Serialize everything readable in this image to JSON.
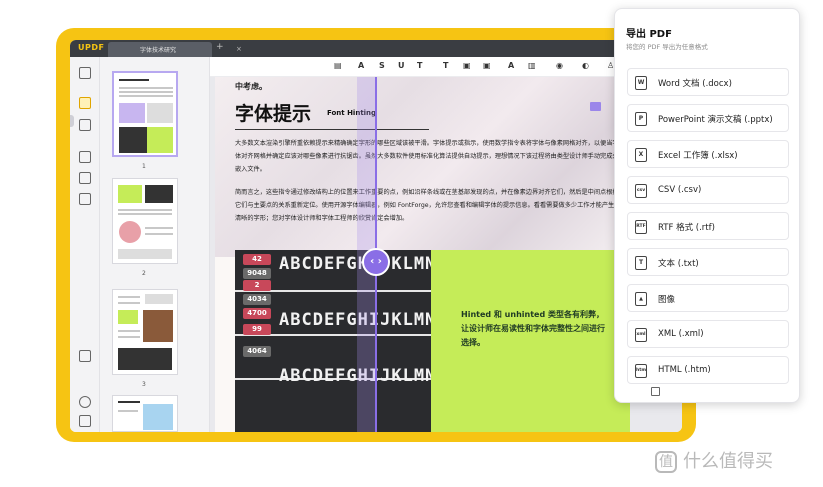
{
  "titlebar": {
    "logo_brand": "UPDF",
    "tab_label": "字体技术研究",
    "tab_close": "×",
    "tab_add": "+"
  },
  "toolbar": {
    "tools": [
      "▤",
      "A",
      "S",
      "U",
      "T",
      "T",
      "▣",
      "▣",
      "A",
      "▥",
      "◉",
      "◐",
      "♙",
      "♙"
    ]
  },
  "thumbnails": {
    "pages": [
      "1",
      "2",
      "3"
    ]
  },
  "document": {
    "top_snippet": "中考虑。",
    "heading": "字体提示",
    "heading_en": "Font Hinting",
    "paragraph1": "大多数文本渲染引擎所重依赖提示来精确确定字形的哪些区域该被平滑。字体提示或指示，使用数学指令表将字体与像素网格对齐，以便当字体对齐网格并确定应该对哪些像素进行抗锯齿。虽然大多数软件使用标准化算法提供自动提示，理想情况下该过程将由类型设计师手动完成并嵌入文件。",
    "paragraph2": "简而言之，这些指令通过修改结构上的位置来工作重要的点，例如沿样条线或在茎基部发现的点，并在像素边界对齐它们，然后是中间点根据它们与主要点的关系重新定位。使用开源字体编辑器，例如 FontForge，允许您查看和编辑字体的提示信息。看看需要做多少工作才能产生清晰的字形；您对字体设计师和字体工程师的欣赏肯定会增加。",
    "photo_lines": [
      "ABCDEFGHIJKLMNO",
      "ABCDEFGHIJKLMNO",
      "ABCDEFGHIJKLMNO"
    ],
    "photo_badges": [
      "42",
      "9048",
      "2",
      "4034",
      "4700",
      "99",
      "4064"
    ],
    "split_handle": "‹ ›",
    "green_text": "Hinted 和 unhinted 类型各有利弊，让设计师在易读性和字体完整性之间进行选择。"
  },
  "export_panel": {
    "title": "导出 PDF",
    "subtitle": "将您的 PDF 导出为任意格式",
    "options": [
      {
        "icon": "W",
        "label": "Word 文档 (.docx)"
      },
      {
        "icon": "P",
        "label": "PowerPoint 演示文稿 (.pptx)"
      },
      {
        "icon": "X",
        "label": "Excel 工作簿 (.xlsx)"
      },
      {
        "icon": "csv",
        "label": "CSV (.csv)"
      },
      {
        "icon": "RTF",
        "label": "RTF 格式 (.rtf)"
      },
      {
        "icon": "T",
        "label": "文本 (.txt)"
      },
      {
        "icon": "▲",
        "label": "图像"
      },
      {
        "icon": "xml",
        "label": "XML (.xml)"
      },
      {
        "icon": "htm",
        "label": "HTML (.htm)"
      }
    ]
  },
  "watermark": {
    "mark": "值",
    "text": "什么值得买"
  },
  "colors": {
    "frame_yellow": "#f6c413",
    "accent_purple": "#8a6ee6",
    "green_panel": "#c5ec58"
  }
}
